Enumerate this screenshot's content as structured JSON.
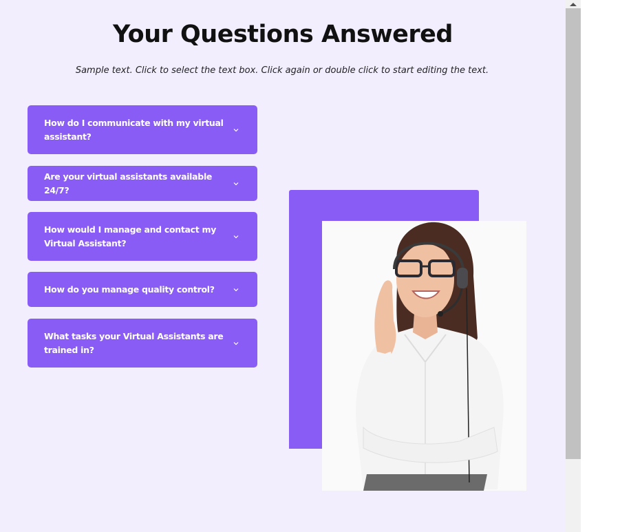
{
  "header": {
    "title": "Your Questions Answered",
    "subtitle": "Sample text. Click to select the text box. Click again or double click to start editing the text."
  },
  "faq": {
    "items": [
      {
        "question": "How do I communicate with my virtual assistant?",
        "icon": "chevron-down-icon"
      },
      {
        "question": "Are your virtual assistants available 24/7?",
        "icon": "chevron-down-icon"
      },
      {
        "question": "How would I manage and contact my Virtual Assistant?",
        "icon": "chevron-down-icon"
      },
      {
        "question": "How do you manage quality control?",
        "icon": "chevron-down-icon"
      },
      {
        "question": "What tasks your Virtual Assistants are trained in?",
        "icon": "chevron-down-icon"
      }
    ]
  },
  "colors": {
    "accent": "#8a5cf6",
    "background": "#f2eefe",
    "title": "#111111",
    "button_text": "#ffffff",
    "scroll_thumb": "#c1c1c1"
  },
  "scrollbar": {
    "up_icon": "arrow-up-icon"
  }
}
